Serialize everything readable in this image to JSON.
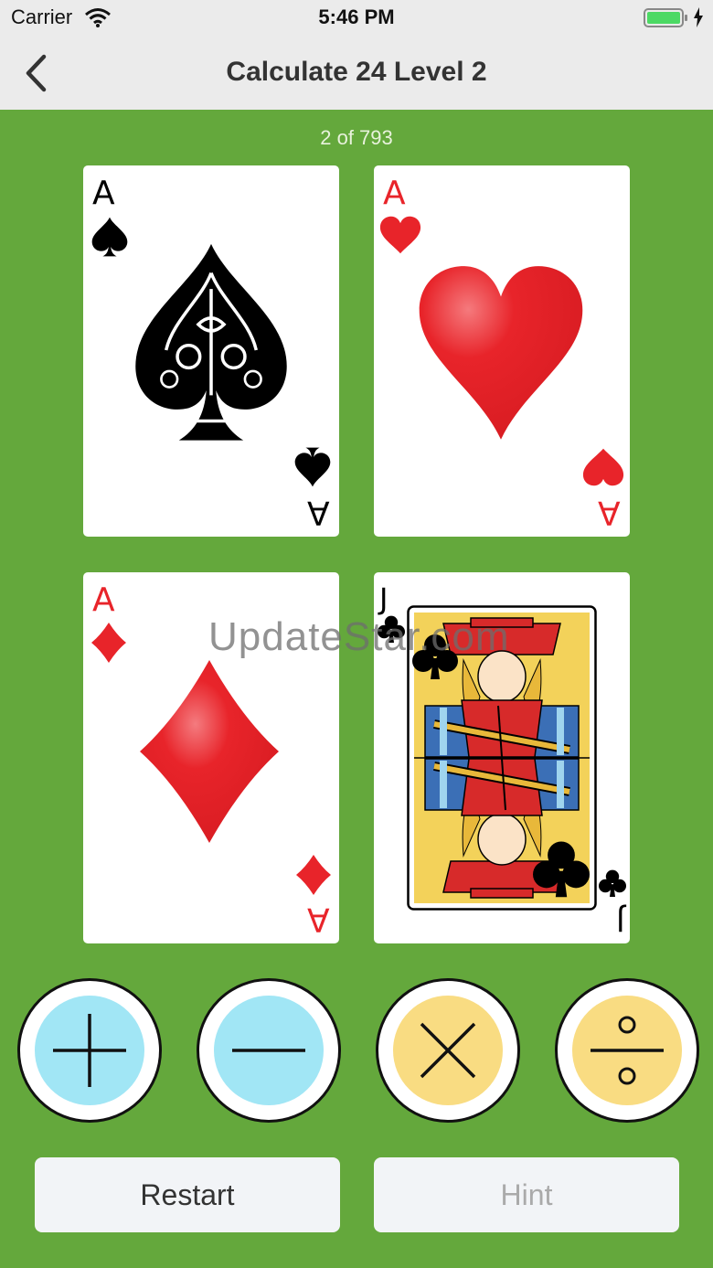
{
  "status": {
    "carrier": "Carrier",
    "time": "5:46 PM"
  },
  "nav": {
    "title": "Calculate 24 Level 2"
  },
  "progress": "2 of 793",
  "cards": [
    {
      "rank": "A",
      "suit": "spades",
      "color": "#000000"
    },
    {
      "rank": "A",
      "suit": "hearts",
      "color": "#e8242a"
    },
    {
      "rank": "A",
      "suit": "diamonds",
      "color": "#e8242a"
    },
    {
      "rank": "J",
      "suit": "clubs",
      "color": "#000000"
    }
  ],
  "operations": [
    {
      "op": "add",
      "icon": "plus-icon",
      "color": "#a1e6f5"
    },
    {
      "op": "subtract",
      "icon": "minus-icon",
      "color": "#a1e6f5"
    },
    {
      "op": "multiply",
      "icon": "times-icon",
      "color": "#f9dc82"
    },
    {
      "op": "divide",
      "icon": "divide-icon",
      "color": "#f9dc82"
    }
  ],
  "buttons": {
    "restart": "Restart",
    "hint": "Hint"
  },
  "watermark": "UpdateStar.com",
  "colors": {
    "felt": "#64a83c",
    "bar": "#ebebeb",
    "red": "#e8242a"
  }
}
